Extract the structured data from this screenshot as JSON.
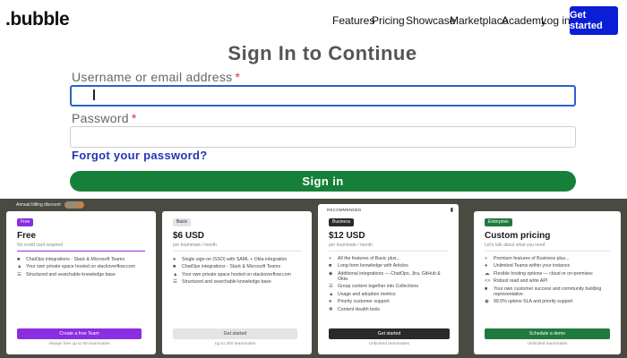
{
  "header": {
    "logo": ".bubble",
    "nav": [
      "Features",
      "Pricing",
      "Showcase",
      "Marketplace",
      "Academy"
    ],
    "login": "Log in",
    "cta": "Get started"
  },
  "form": {
    "title": "Sign In to Continue",
    "username_label": "Username or email address",
    "password_label": "Password",
    "required_mark": "*",
    "forgot": "Forgot your password?",
    "submit": "Sign in"
  },
  "pricing": {
    "billing_label": "Annual billing discount",
    "plans": [
      {
        "badge": "Free",
        "price": "Free",
        "sub": "No credit card required",
        "features": [
          "ChatOps integrations - Slack & Microsoft Teams",
          "Your own private space hosted on stackoverflow.com",
          "Structured and searchable knowledge base"
        ],
        "button": "Create a free Team",
        "footnote": "Always free up to 50 teammates"
      },
      {
        "badge": "Basic",
        "price": "$6 USD",
        "sub": "per teammate / month",
        "features": [
          "Single sign-on (SSO) with SAML + Okta integration",
          "ChatOps integrations - Slack & Microsoft Teams",
          "Your own private space hosted on stackoverflow.com",
          "Structured and searchable knowledge base"
        ],
        "button": "Get started",
        "footnote": "Up to 250 teammates"
      },
      {
        "recommended": "RECOMMENDED",
        "badge": "Business",
        "price": "$12 USD",
        "sub": "per teammate / month",
        "features": [
          "All the features of Basic plus...",
          "Long-form knowledge with Articles",
          "Additional integrations — ChatOps, Jira, GitHub & Okta",
          "Group content together into Collections",
          "Usage and adoption metrics",
          "Priority customer support",
          "Content Health tools"
        ],
        "button": "Get started",
        "footnote": "Unlimited teammates"
      },
      {
        "badge": "Enterprise",
        "price": "Custom pricing",
        "sub": "Let's talk about what you need",
        "features": [
          "Premium features of Business plus...",
          "Unlimited Teams within your instance",
          "Flexible hosting options — cloud or on-premises",
          "Robust read and write API",
          "Your own customer success and community building representative",
          "99.5% uptime SLA and priority support"
        ],
        "button": "Schedule a demo",
        "footnote": "Unlimited teammates"
      }
    ]
  },
  "colors": {
    "primary_blue": "#0a1ed6",
    "focus_blue": "#2a62c9",
    "signin_green": "#16803a",
    "link_blue": "#2435b5",
    "pricing_bg": "#4a4a43",
    "free_purple": "#8b2de0",
    "enterprise_green": "#1f7a3e"
  }
}
